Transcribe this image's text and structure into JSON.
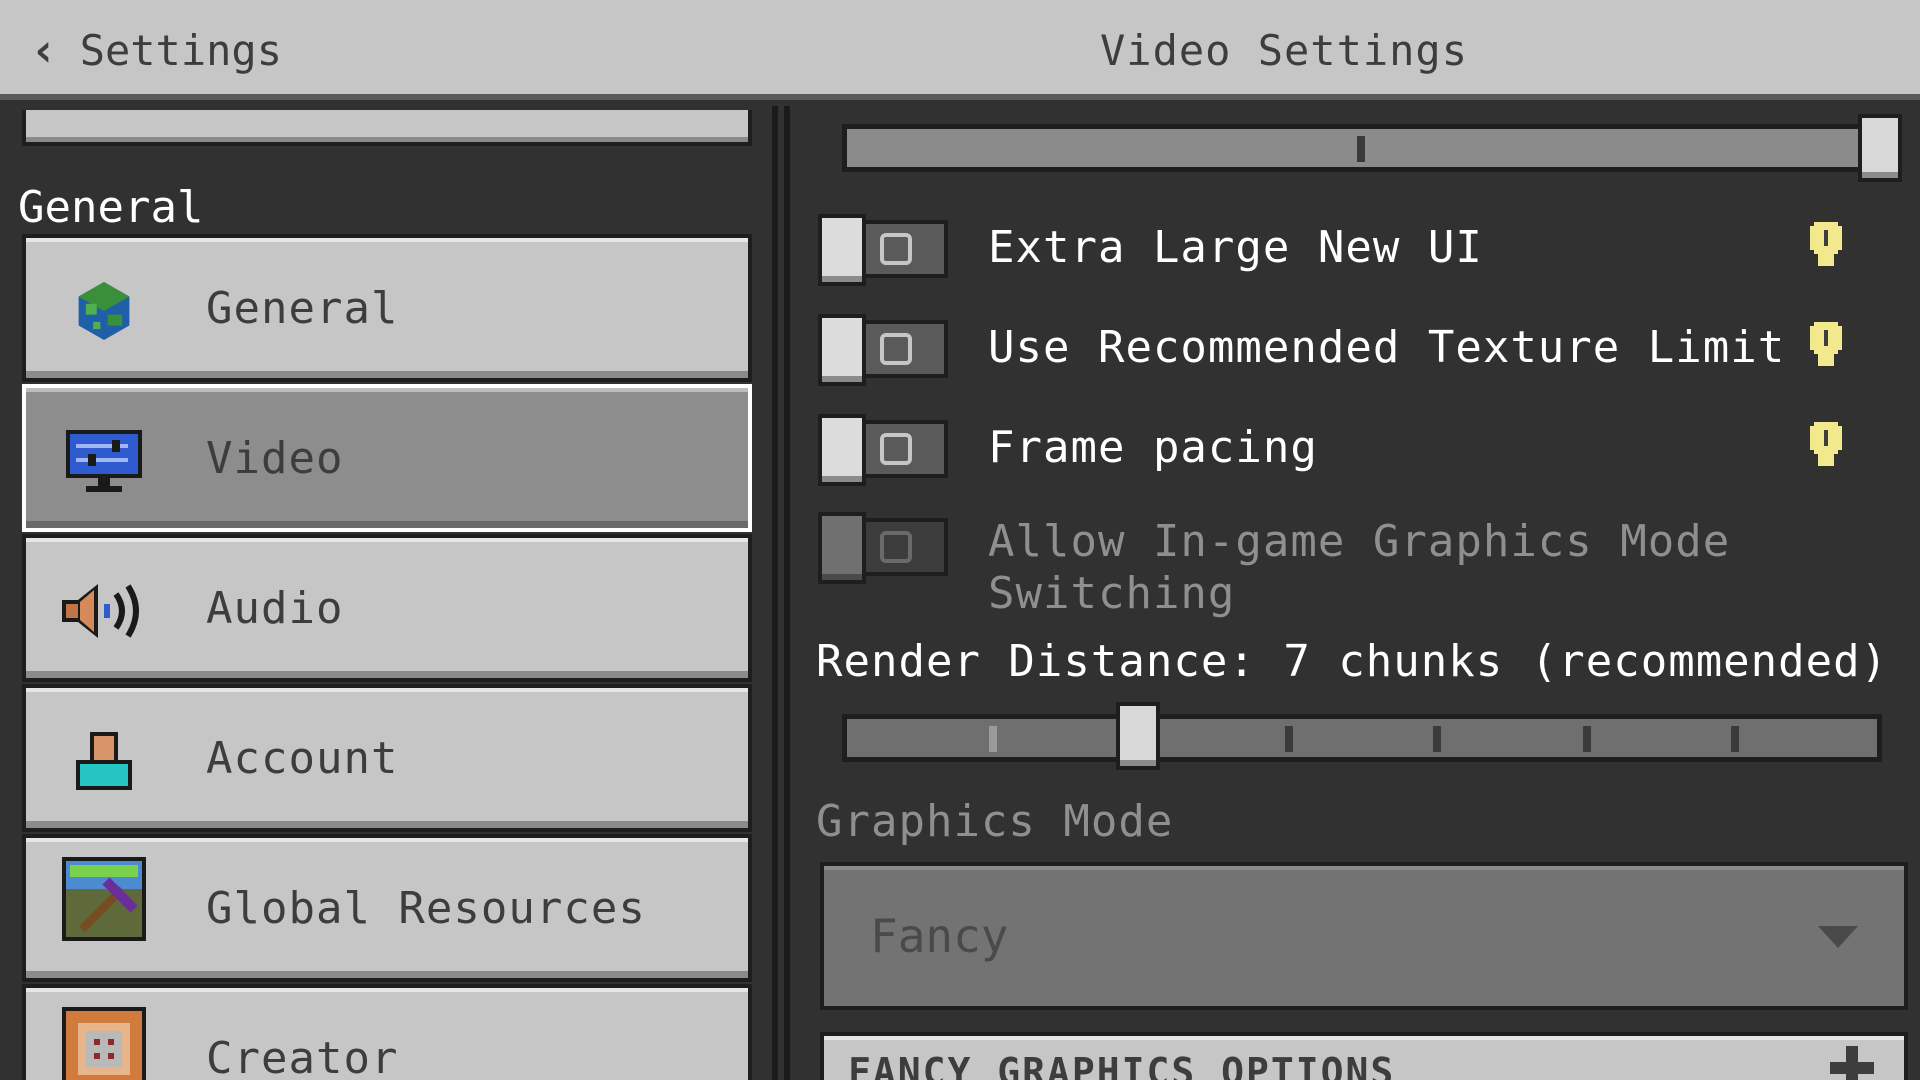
{
  "header": {
    "back_label": "Settings",
    "title": "Video Settings"
  },
  "sidebar": {
    "section_title": "General",
    "items": [
      {
        "label": "General",
        "icon": "globe-icon",
        "selected": false
      },
      {
        "label": "Video",
        "icon": "monitor-icon",
        "selected": true
      },
      {
        "label": "Audio",
        "icon": "speaker-icon",
        "selected": false
      },
      {
        "label": "Account",
        "icon": "person-icon",
        "selected": false
      },
      {
        "label": "Global Resources",
        "icon": "resource-pack-icon",
        "selected": false
      },
      {
        "label": "Creator",
        "icon": "command-block-icon",
        "selected": false
      }
    ]
  },
  "main": {
    "toggles": [
      {
        "label": "Extra Large New UI",
        "on": false,
        "disabled": false,
        "has_info": true
      },
      {
        "label": "Use Recommended Texture Limit",
        "on": false,
        "disabled": false,
        "has_info": true
      },
      {
        "label": "Frame pacing",
        "on": false,
        "disabled": false,
        "has_info": true
      },
      {
        "label": "Allow In-game Graphics Mode Switching",
        "on": false,
        "disabled": true,
        "has_info": false
      }
    ],
    "render_distance_label": "Render Distance: 7 chunks (recommended)",
    "render_distance_value": 7,
    "graphics_mode_label": "Graphics Mode",
    "graphics_mode_value": "Fancy",
    "fancy_section_label": "FANCY GRAPHICS OPTIONS"
  },
  "colors": {
    "panel_bg": "#313131",
    "button_light": "#c6c6c6",
    "button_selected": "#8d8d8d",
    "info_yellow": "#f2e98c"
  }
}
